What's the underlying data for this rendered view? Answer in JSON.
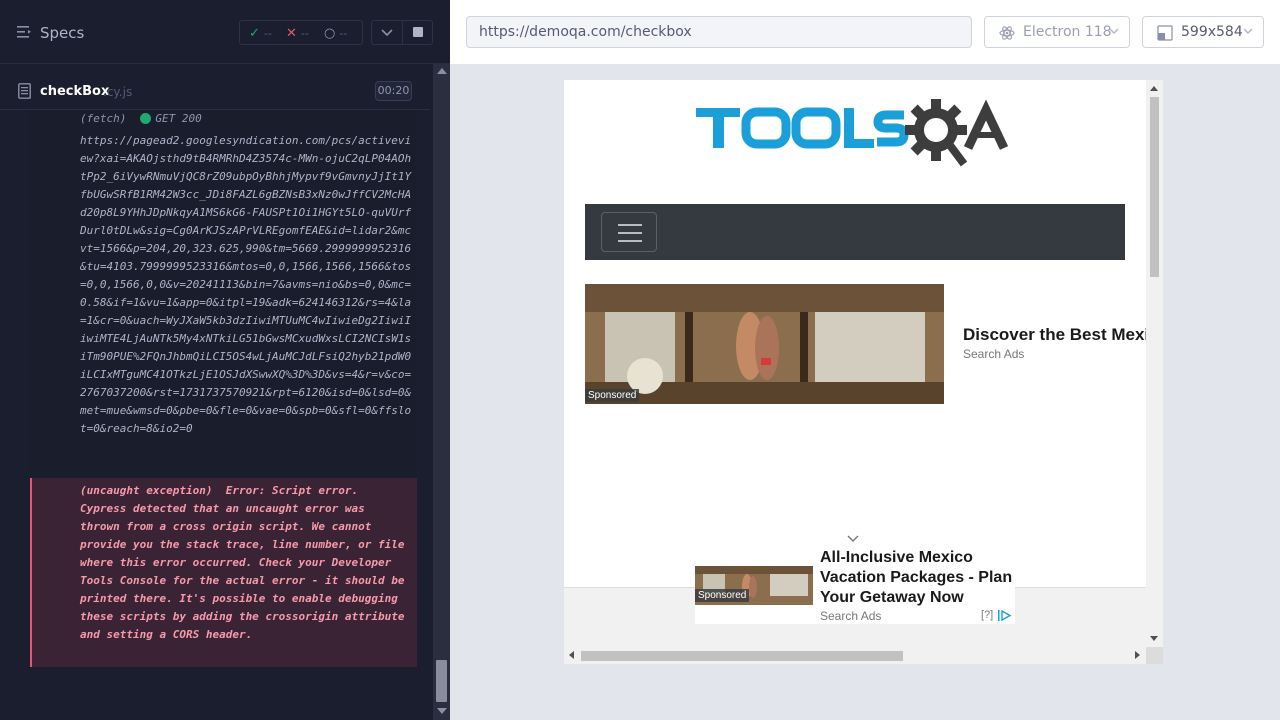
{
  "reporter": {
    "title": "Specs",
    "stats": {
      "passed": "--",
      "failed": "--",
      "pending": "--"
    },
    "spec": {
      "name": "checkBox",
      "ext": ".cy.js",
      "duration": "00:20"
    },
    "log": {
      "fetch_label": "(fetch)",
      "fetch_method": "GET 200",
      "fetch_url": "https://pagead2.googlesyndication.com/pcs/activeview?xai=AKAOjsthd9tB4RMRhD4Z3574c-MWn-ojuC2qLP04AOhtPp2_6iVywRNmuVjQC8rZ09ubpOyBhhjMypvf9vGmvnyJjIt1YfbUGwSRfB1RM42W3cc_JDi8FAZL6gBZNsB3xNz0wJffCV2McHAd20p8L9YHhJDpNkqyA1MS6kG6-FAUSPt1Oi1HGYt5LO-quVUrfDurl0tDLw&sig=Cg0ArKJSzAPrVLREgomfEAE&id=lidar2&mcvt=1566&p=204,20,323.625,990&tm=5669.2999999952316&tu=4103.7999999523316&mtos=0,0,1566,1566,1566&tos=0,0,1566,0,0&v=20241113&bin=7&avms=nio&bs=0,0&mc=0.58&if=1&vu=1&app=0&itpl=19&adk=624146312&rs=4&la=1&cr=0&uach=WyJXaW5kb3dzIiwiMTUuMC4wIiwieDg2IiwiIiwiMTE4LjAuNTk5My4xNTkiLG51bGwsMCxudWxsLCI2NCIsW1siTm90PUE%2FQnJhbmQiLCI5OS4wLjAuMCJdLFsiQ2hyb21pdW0iLCIxMTguMC41OTkzLjE1OSJdXSwwXQ%3D%3D&vs=4&r=v&co=2767037200&rst=1731737570921&rpt=6120&isd=0&lsd=0&met=mue&wmsd=0&pbe=0&fle=0&vae=0&spb=0&sfl=0&ffslot=0&reach=8&io2=0",
      "error_text": "(uncaught exception)  Error: Script error.\nCypress detected that an uncaught error was thrown from a cross origin script. We cannot provide you the stack trace, line number, or file where this error occurred. Check your Developer Tools Console for the actual error - it should be printed there. It's possible to enable debugging these scripts by adding the crossorigin attribute and setting a CORS header."
    }
  },
  "aut": {
    "url": "https://demoqa.com/checkbox",
    "browser": "Electron 118",
    "viewport": "599x584",
    "site": {
      "logo_text": "TOOLSQA",
      "ad1": {
        "title": "Discover the Best Mexic",
        "source": "Search Ads",
        "tag": "Sponsored"
      },
      "ad2": {
        "title": "All-Inclusive Mexico Vacation Packages - Plan Your Getaway Now",
        "source": "Search Ads",
        "help": "[?]",
        "tag": "Sponsored"
      }
    }
  },
  "colors": {
    "reporter_bg": "#1b1e2e",
    "pass": "#1fa971",
    "fail": "#e45770",
    "error_bg": "#3b2336",
    "toolsqa_blue": "#1a9fd9",
    "toolsqa_dark": "#3d3d3d",
    "navbar": "#343a40"
  }
}
